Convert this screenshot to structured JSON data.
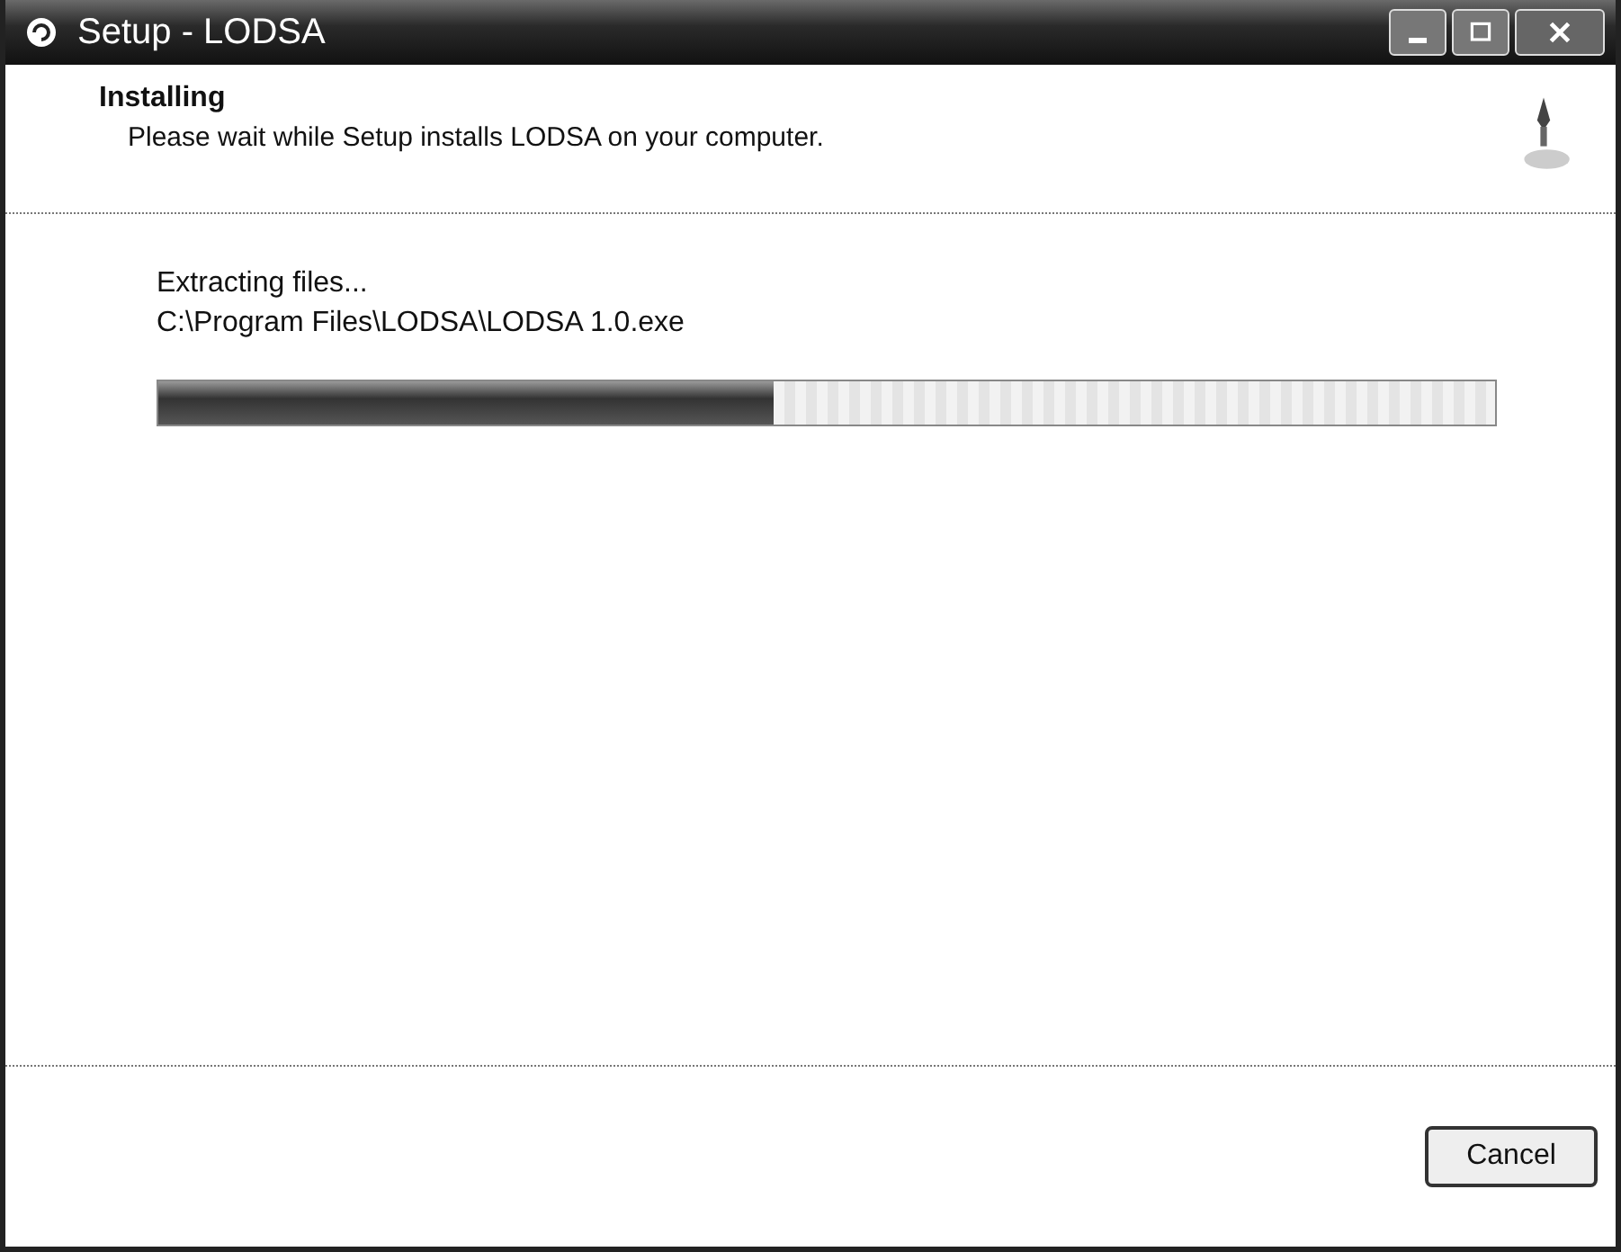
{
  "window": {
    "title": "Setup - LODSA"
  },
  "header": {
    "title": "Installing",
    "subtitle": "Please wait while Setup installs LODSA on your computer."
  },
  "status": {
    "action": "Extracting files...",
    "file": "C:\\Program Files\\LODSA\\LODSA 1.0.exe"
  },
  "progress": {
    "level": 0.46
  },
  "buttons": [
    {
      "label": "Cancel",
      "disabled": false
    }
  ]
}
